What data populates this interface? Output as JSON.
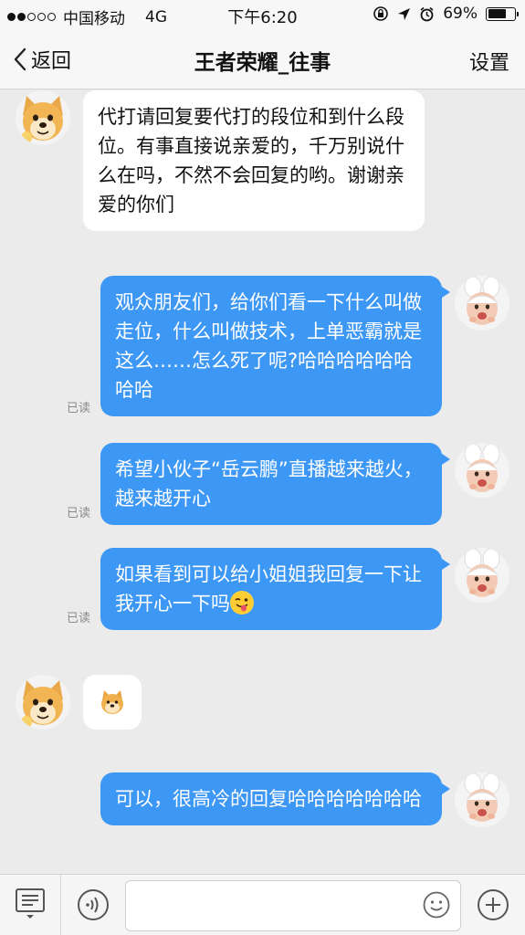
{
  "status_bar": {
    "carrier": "中国移动",
    "network": "4G",
    "time": "下午6:20",
    "battery": "69%",
    "battery_level": 0.69
  },
  "nav": {
    "back_label": "返回",
    "title": "王者荣耀_往事",
    "settings_label": "设置"
  },
  "messages": [
    {
      "from": "them",
      "avatar": "shiba-doge-avatar",
      "text": "代打请回复要代打的段位和到什么段位。有事直接说亲爱的，千万别说什么在吗，不然不会回复的哟。谢谢亲爱的你们"
    },
    {
      "from": "me",
      "avatar": "baby-bunny-ears-avatar",
      "text": "观众朋友们，给你们看一下什么叫做走位，什么叫做技术，上单恶霸就是这么……怎么死了呢?哈哈哈哈哈哈哈哈",
      "status": "已读"
    },
    {
      "from": "me",
      "avatar": "baby-bunny-ears-avatar",
      "text": "希望小伙子“岳云鹏”直播越来越火，越来越开心",
      "status": "已读"
    },
    {
      "from": "me",
      "avatar": "baby-bunny-ears-avatar",
      "text": "如果看到可以给小姐姐我回复一下让我开心一下吗",
      "emoji": "winking-tongue-emoji",
      "status": "已读"
    },
    {
      "from": "them",
      "avatar": "shiba-doge-avatar",
      "sticker": "doge-sticker-icon"
    },
    {
      "from": "me",
      "avatar": "baby-bunny-ears-avatar",
      "text": "可以，很高冷的回复哈哈哈哈哈哈哈"
    }
  ],
  "input_bar": {
    "placeholder": "",
    "icons": [
      "keyboard-menu-icon",
      "voice-icon",
      "emoji-icon",
      "plus-icon"
    ]
  },
  "colors": {
    "outgoing_bubble": "#3d97f4",
    "incoming_bubble": "#ffffff",
    "background": "#ebebeb"
  }
}
